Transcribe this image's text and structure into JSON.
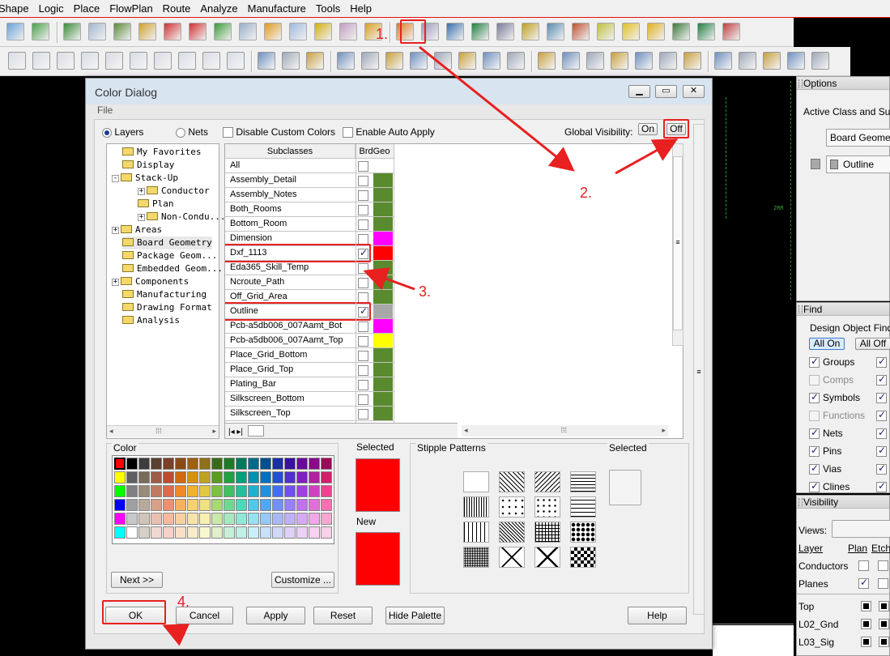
{
  "menu": [
    "Shape",
    "Logic",
    "Place",
    "FlowPlan",
    "Route",
    "Analyze",
    "Manufacture",
    "Tools",
    "Help"
  ],
  "dialog": {
    "title": "Color Dialog",
    "file_menu": "File",
    "radio_layers": "Layers",
    "radio_nets": "Nets",
    "disable_custom": "Disable Custom Colors",
    "enable_auto": "Enable Auto Apply",
    "global_visibility": "Global Visibility:",
    "on_label": "On",
    "off_label": "Off",
    "tree": [
      {
        "label": "My Favorites",
        "indent": 1,
        "exp": ""
      },
      {
        "label": "Display",
        "indent": 1,
        "exp": ""
      },
      {
        "label": "Stack-Up",
        "indent": 0,
        "exp": "-"
      },
      {
        "label": "Conductor",
        "indent": 2,
        "exp": "+"
      },
      {
        "label": "Plan",
        "indent": 2,
        "exp": ""
      },
      {
        "label": "Non-Condu...",
        "indent": 2,
        "exp": "+"
      },
      {
        "label": "Areas",
        "indent": 0,
        "exp": "+"
      },
      {
        "label": "Board Geometry",
        "indent": 1,
        "exp": ""
      },
      {
        "label": "Package Geom...",
        "indent": 1,
        "exp": ""
      },
      {
        "label": "Embedded Geom...",
        "indent": 1,
        "exp": ""
      },
      {
        "label": "Components",
        "indent": 0,
        "exp": "+"
      },
      {
        "label": "Manufacturing",
        "indent": 1,
        "exp": ""
      },
      {
        "label": "Drawing Format",
        "indent": 1,
        "exp": ""
      },
      {
        "label": "Analysis",
        "indent": 1,
        "exp": ""
      }
    ],
    "grid_header": {
      "subclasses": "Subclasses",
      "brdgeo": "BrdGeo"
    },
    "subclasses": [
      {
        "name": "All",
        "checked": false,
        "color": "#ffffff"
      },
      {
        "name": "Assembly_Detail",
        "checked": false,
        "color": "#5a8a2e"
      },
      {
        "name": "Assembly_Notes",
        "checked": false,
        "color": "#5a8a2e"
      },
      {
        "name": "Both_Rooms",
        "checked": false,
        "color": "#5a8a2e"
      },
      {
        "name": "Bottom_Room",
        "checked": false,
        "color": "#5a8a2e"
      },
      {
        "name": "Dimension",
        "checked": false,
        "color": "#ff00ff"
      },
      {
        "name": "Dxf_1113",
        "checked": true,
        "color": "#ff0000"
      },
      {
        "name": "Eda365_Skill_Temp",
        "checked": false,
        "color": "#5a8a2e"
      },
      {
        "name": "Ncroute_Path",
        "checked": false,
        "color": "#5a8a2e"
      },
      {
        "name": "Off_Grid_Area",
        "checked": false,
        "color": "#5a8a2e"
      },
      {
        "name": "Outline",
        "checked": true,
        "color": "#a8a8a8"
      },
      {
        "name": "Pcb-a5db006_007Aamt_Bot",
        "checked": false,
        "color": "#ff00ff"
      },
      {
        "name": "Pcb-a5db006_007Aamt_Top",
        "checked": false,
        "color": "#ffff00"
      },
      {
        "name": "Place_Grid_Bottom",
        "checked": false,
        "color": "#5a8a2e"
      },
      {
        "name": "Place_Grid_Top",
        "checked": false,
        "color": "#5a8a2e"
      },
      {
        "name": "Plating_Bar",
        "checked": false,
        "color": "#5a8a2e"
      },
      {
        "name": "Silkscreen_Bottom",
        "checked": false,
        "color": "#5a8a2e"
      },
      {
        "name": "Silkscreen_Top",
        "checked": false,
        "color": "#5a8a2e"
      }
    ],
    "color_label": "Color",
    "selected_label": "Selected",
    "new_label": "New",
    "stipple_label": "Stipple Patterns",
    "stipple_selected": "Selected",
    "palette": [
      [
        "#ff0000",
        "#000000",
        "#3c3c3c",
        "#5a4030",
        "#7a4028",
        "#8a4a18",
        "#a06010",
        "#907018",
        "#3a6a18",
        "#207a2a",
        "#007a5a",
        "#006a8a",
        "#00508a",
        "#1830a0",
        "#3a10a0",
        "#6a0a9a",
        "#8a0a8a",
        "#9a0a5a"
      ],
      [
        "#ffff00",
        "#606060",
        "#7a6a5a",
        "#a05a48",
        "#c04a30",
        "#d06a10",
        "#d89010",
        "#c0a020",
        "#5a9a20",
        "#20a040",
        "#00a07a",
        "#0090b0",
        "#0070c0",
        "#2050d0",
        "#5030d0",
        "#8020c0",
        "#b020a0",
        "#d0206a"
      ],
      [
        "#00ff00",
        "#808080",
        "#9a8a7a",
        "#c07a60",
        "#e06a48",
        "#f08a28",
        "#f0b030",
        "#e0c840",
        "#80c040",
        "#40c060",
        "#20c09a",
        "#20b0d0",
        "#2090e0",
        "#4070f0",
        "#7050f0",
        "#a040e0",
        "#d040c0",
        "#f04090"
      ],
      [
        "#0000ff",
        "#a0a0a0",
        "#b8aa9a",
        "#d8a088",
        "#f09070",
        "#f8b060",
        "#f8d070",
        "#f0e080",
        "#a8d870",
        "#70d890",
        "#50d8b8",
        "#50c8e8",
        "#50a8f0",
        "#7090f8",
        "#9880f8",
        "#c070f0",
        "#e070d8",
        "#f870b0"
      ],
      [
        "#ff00ff",
        "#c8c8c8",
        "#d0c4b8",
        "#e8c0b0",
        "#f8b8a0",
        "#f8d0a0",
        "#f8e4a8",
        "#f8f0b0",
        "#c8e8a8",
        "#a8e8c0",
        "#90e8d8",
        "#98e0f0",
        "#98c8f8",
        "#a8b8f8",
        "#c0b0f8",
        "#d8a8f8",
        "#f0a8e8",
        "#f8a8d0"
      ],
      [
        "#00ffff",
        "#ffffff",
        "#d8d0c8",
        "#f0d8d0",
        "#f8d0c8",
        "#f8e0c8",
        "#f8ecc8",
        "#f8f8d0",
        "#e0f0c8",
        "#c8f0d8",
        "#c0f0e8",
        "#c8f0f8",
        "#c8e0f8",
        "#d0d8f8",
        "#e0d0f8",
        "#ecd0f8",
        "#f8d0f0",
        "#f8d0e8"
      ]
    ],
    "selected_color": "#ff0000",
    "new_color": "#ff0000",
    "buttons": {
      "next": "Next >>",
      "customize": "Customize ...",
      "ok": "OK",
      "cancel": "Cancel",
      "apply": "Apply",
      "reset": "Reset",
      "hide_palette": "Hide Palette",
      "help": "Help"
    }
  },
  "options_panel": {
    "title": "Options",
    "active_class": "Active Class and Subc",
    "class_value": "Board Geometry",
    "subclass_value": "Outline"
  },
  "find_panel": {
    "title": "Find",
    "heading": "Design Object Find F",
    "all_on": "All On",
    "all_off": "All Off",
    "items": [
      {
        "label": "Groups",
        "checked": true,
        "enabled": true
      },
      {
        "label": "Comps",
        "checked": false,
        "enabled": false
      },
      {
        "label": "Symbols",
        "checked": true,
        "enabled": true
      },
      {
        "label": "Functions",
        "checked": false,
        "enabled": false
      },
      {
        "label": "Nets",
        "checked": true,
        "enabled": true
      },
      {
        "label": "Pins",
        "checked": true,
        "enabled": true
      },
      {
        "label": "Vias",
        "checked": true,
        "enabled": true
      },
      {
        "label": "Clines",
        "checked": true,
        "enabled": true
      }
    ]
  },
  "visibility_panel": {
    "title": "Visibility",
    "views_label": "Views:",
    "col_layer": "Layer",
    "col_plan": "Plan",
    "col_etch": "Etch",
    "groups": [
      {
        "label": "Conductors",
        "plan": false
      },
      {
        "label": "Planes",
        "plan": true
      }
    ],
    "layers": [
      "Top",
      "L02_Gnd",
      "L03_Sig"
    ]
  },
  "annotations": [
    "1.",
    "2.",
    "3.",
    "4."
  ],
  "canvas_text": [
    "2RR"
  ]
}
